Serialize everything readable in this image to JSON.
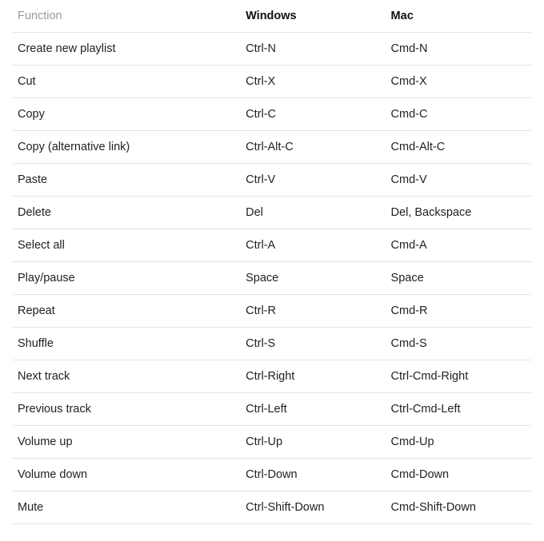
{
  "table": {
    "headers": {
      "function": "Function",
      "windows": "Windows",
      "mac": "Mac"
    },
    "rows": [
      {
        "function": "Create new playlist",
        "windows": "Ctrl-N",
        "mac": "Cmd-N"
      },
      {
        "function": "Cut",
        "windows": "Ctrl-X",
        "mac": "Cmd-X"
      },
      {
        "function": "Copy",
        "windows": "Ctrl-C",
        "mac": "Cmd-C"
      },
      {
        "function": "Copy (alternative link)",
        "windows": "Ctrl-Alt-C",
        "mac": "Cmd-Alt-C"
      },
      {
        "function": "Paste",
        "windows": "Ctrl-V",
        "mac": "Cmd-V"
      },
      {
        "function": "Delete",
        "windows": "Del",
        "mac": "Del, Backspace"
      },
      {
        "function": "Select all",
        "windows": "Ctrl-A",
        "mac": "Cmd-A"
      },
      {
        "function": "Play/pause",
        "windows": "Space",
        "mac": "Space"
      },
      {
        "function": "Repeat",
        "windows": "Ctrl-R",
        "mac": "Cmd-R"
      },
      {
        "function": "Shuffle",
        "windows": "Ctrl-S",
        "mac": "Cmd-S"
      },
      {
        "function": "Next track",
        "windows": "Ctrl-Right",
        "mac": "Ctrl-Cmd-Right"
      },
      {
        "function": "Previous track",
        "windows": "Ctrl-Left",
        "mac": "Ctrl-Cmd-Left"
      },
      {
        "function": "Volume up",
        "windows": "Ctrl-Up",
        "mac": "Cmd-Up"
      },
      {
        "function": "Volume down",
        "windows": "Ctrl-Down",
        "mac": "Cmd-Down"
      },
      {
        "function": "Mute",
        "windows": "Ctrl-Shift-Down",
        "mac": "Cmd-Shift-Down"
      }
    ]
  }
}
